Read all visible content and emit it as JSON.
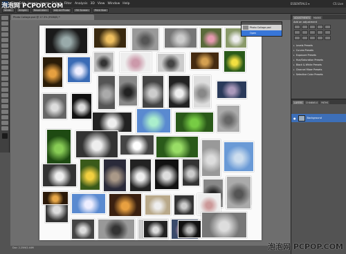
{
  "watermark": {
    "top": "泡泡网 PCPOP.COM",
    "bottom": "泡泡网 PCPOP.COM"
  },
  "menubar": {
    "app_badge": "Ps",
    "items": [
      "File",
      "Edit",
      "Image",
      "Layer",
      "Select",
      "Filter",
      "Analysis",
      "3D",
      "View",
      "Window",
      "Help"
    ],
    "workspace": "ESSENTIALS ▾",
    "cs_live": "CS Live"
  },
  "optionsbar": {
    "fields": [
      "Width:",
      "Height:",
      "Resolution:",
      "Adjust Photo",
      "Fill Screen",
      "Print Size"
    ]
  },
  "document": {
    "tab": "Photo Collage.psd @ 17.3% (RGB/8) *",
    "status": "Doc: 2.25M/2.44M"
  },
  "history": {
    "items": [
      {
        "label": "Photo Collage.psd",
        "selected": false
      },
      {
        "label": "Open",
        "selected": true
      }
    ]
  },
  "right_panel": {
    "tabs": [
      "ADJUSTMENTS",
      "MASKS"
    ],
    "adj_title": "Add an adjustment",
    "presets": [
      "Levels Presets",
      "Curves Presets",
      "Exposure Presets",
      "Hue/Saturation Presets",
      "Black & White Presets",
      "Channel Mixer Presets",
      "Selective Color Presets"
    ],
    "layers_tabs": [
      "LAYERS",
      "CHANNELS",
      "PATHS"
    ],
    "layer_name": "Background"
  },
  "photos": [
    {
      "name": "photo-tree-silhouette",
      "fill": "#1a1a1a",
      "accent": "#9aa"
    },
    {
      "name": "photo-sunset-1",
      "fill": "#3a2a10",
      "accent": "#f0c060"
    },
    {
      "name": "photo-water-bw",
      "fill": "#999",
      "accent": "#555"
    },
    {
      "name": "photo-ocean-bw",
      "fill": "#777",
      "accent": "#ccc"
    },
    {
      "name": "photo-pink-flower",
      "fill": "#5a6a3a",
      "accent": "#e79ab0"
    },
    {
      "name": "photo-white-flowers",
      "fill": "#8a9a6a",
      "accent": "#eee"
    },
    {
      "name": "photo-sunset-2",
      "fill": "#2a1c08",
      "accent": "#e6a040"
    },
    {
      "name": "photo-sky",
      "fill": "#3a6bb5",
      "accent": "#eef"
    },
    {
      "name": "photo-people-bw-1",
      "fill": "#bbb",
      "accent": "#333"
    },
    {
      "name": "photo-mother-child",
      "fill": "#eee",
      "accent": "#c9a"
    },
    {
      "name": "photo-flower-bw-1",
      "fill": "#ccc",
      "accent": "#444"
    },
    {
      "name": "photo-pier-sunset",
      "fill": "#442a10",
      "accent": "#d4a050"
    },
    {
      "name": "photo-yellow-flower",
      "fill": "#2a5a1a",
      "accent": "#f2e040"
    },
    {
      "name": "photo-people-bw-2",
      "fill": "#666",
      "accent": "#ddd"
    },
    {
      "name": "photo-white-flower-2",
      "fill": "#111",
      "accent": "#ddd"
    },
    {
      "name": "photo-lake-bw",
      "fill": "#555",
      "accent": "#aaa"
    },
    {
      "name": "photo-trees-bw",
      "fill": "#888",
      "accent": "#222"
    },
    {
      "name": "photo-children-bw",
      "fill": "#444",
      "accent": "#ccc"
    },
    {
      "name": "photo-couple-bw",
      "fill": "#222",
      "accent": "#eee"
    },
    {
      "name": "photo-bride",
      "fill": "#ddd",
      "accent": "#888"
    },
    {
      "name": "photo-dusk-sea",
      "fill": "#2a3a5a",
      "accent": "#a9b"
    },
    {
      "name": "photo-orchid-bw",
      "fill": "#222",
      "accent": "#eee"
    },
    {
      "name": "photo-coast-color",
      "fill": "#5a8ad0",
      "accent": "#aec"
    },
    {
      "name": "photo-palm-1",
      "fill": "#2b5a1a",
      "accent": "#7c4"
    },
    {
      "name": "photo-landscape-bw",
      "fill": "#aaa",
      "accent": "#666"
    },
    {
      "name": "photo-palm-2",
      "fill": "#1e4a12",
      "accent": "#8c5"
    },
    {
      "name": "photo-white-flower-3",
      "fill": "#333",
      "accent": "#eee"
    },
    {
      "name": "photo-white-flower-4",
      "fill": "#444",
      "accent": "#fff"
    },
    {
      "name": "photo-leaves",
      "fill": "#2a5a1a",
      "accent": "#9d6"
    },
    {
      "name": "photo-beach-bw",
      "fill": "#999",
      "accent": "#ddd"
    },
    {
      "name": "photo-blue-sky",
      "fill": "#6a9ad6",
      "accent": "#cde"
    },
    {
      "name": "photo-white-flower-5",
      "fill": "#333",
      "accent": "#eee"
    },
    {
      "name": "photo-yellow-flower-2",
      "fill": "#3a5a1a",
      "accent": "#f2d040"
    },
    {
      "name": "photo-harbor",
      "fill": "#2a2a3a",
      "accent": "#a98"
    },
    {
      "name": "photo-white-lily",
      "fill": "#222",
      "accent": "#eee"
    },
    {
      "name": "photo-lily-bw",
      "fill": "#111",
      "accent": "#ddd"
    },
    {
      "name": "photo-kids-bw",
      "fill": "#333",
      "accent": "#ccc"
    },
    {
      "name": "photo-tree-bw",
      "fill": "#888",
      "accent": "#222"
    },
    {
      "name": "photo-dark-flower",
      "fill": "#111",
      "accent": "#eee"
    },
    {
      "name": "photo-rose-bw",
      "fill": "#333",
      "accent": "#ddd"
    },
    {
      "name": "photo-ocean-blue",
      "fill": "#5a8ad0",
      "accent": "#eef"
    },
    {
      "name": "photo-sunset-3",
      "fill": "#3a2010",
      "accent": "#e8a040"
    },
    {
      "name": "photo-sand",
      "fill": "#b9a98a",
      "accent": "#eee"
    },
    {
      "name": "photo-boat-bw",
      "fill": "#333",
      "accent": "#ccc"
    },
    {
      "name": "photo-child-sepia",
      "fill": "#eee",
      "accent": "#c99"
    },
    {
      "name": "photo-flower-bw-6",
      "fill": "#444",
      "accent": "#ddd"
    },
    {
      "name": "photo-leaf-bw",
      "fill": "#999",
      "accent": "#333"
    },
    {
      "name": "photo-white-rose",
      "fill": "#ccc",
      "accent": "#fff"
    },
    {
      "name": "photo-pink-flower-2",
      "fill": "#3a4a6a",
      "accent": "#e7a0c0"
    },
    {
      "name": "photo-water-bw-2",
      "fill": "#777",
      "accent": "#ddd"
    },
    {
      "name": "photo-reeds-bw",
      "fill": "#aaa",
      "accent": "#555"
    },
    {
      "name": "photo-sunset-4",
      "fill": "#2a1808",
      "accent": "#e8a848"
    },
    {
      "name": "photo-wave-bw",
      "fill": "#222",
      "accent": "#ddd"
    },
    {
      "name": "photo-pier-bw",
      "fill": "#111",
      "accent": "#bbb"
    }
  ]
}
